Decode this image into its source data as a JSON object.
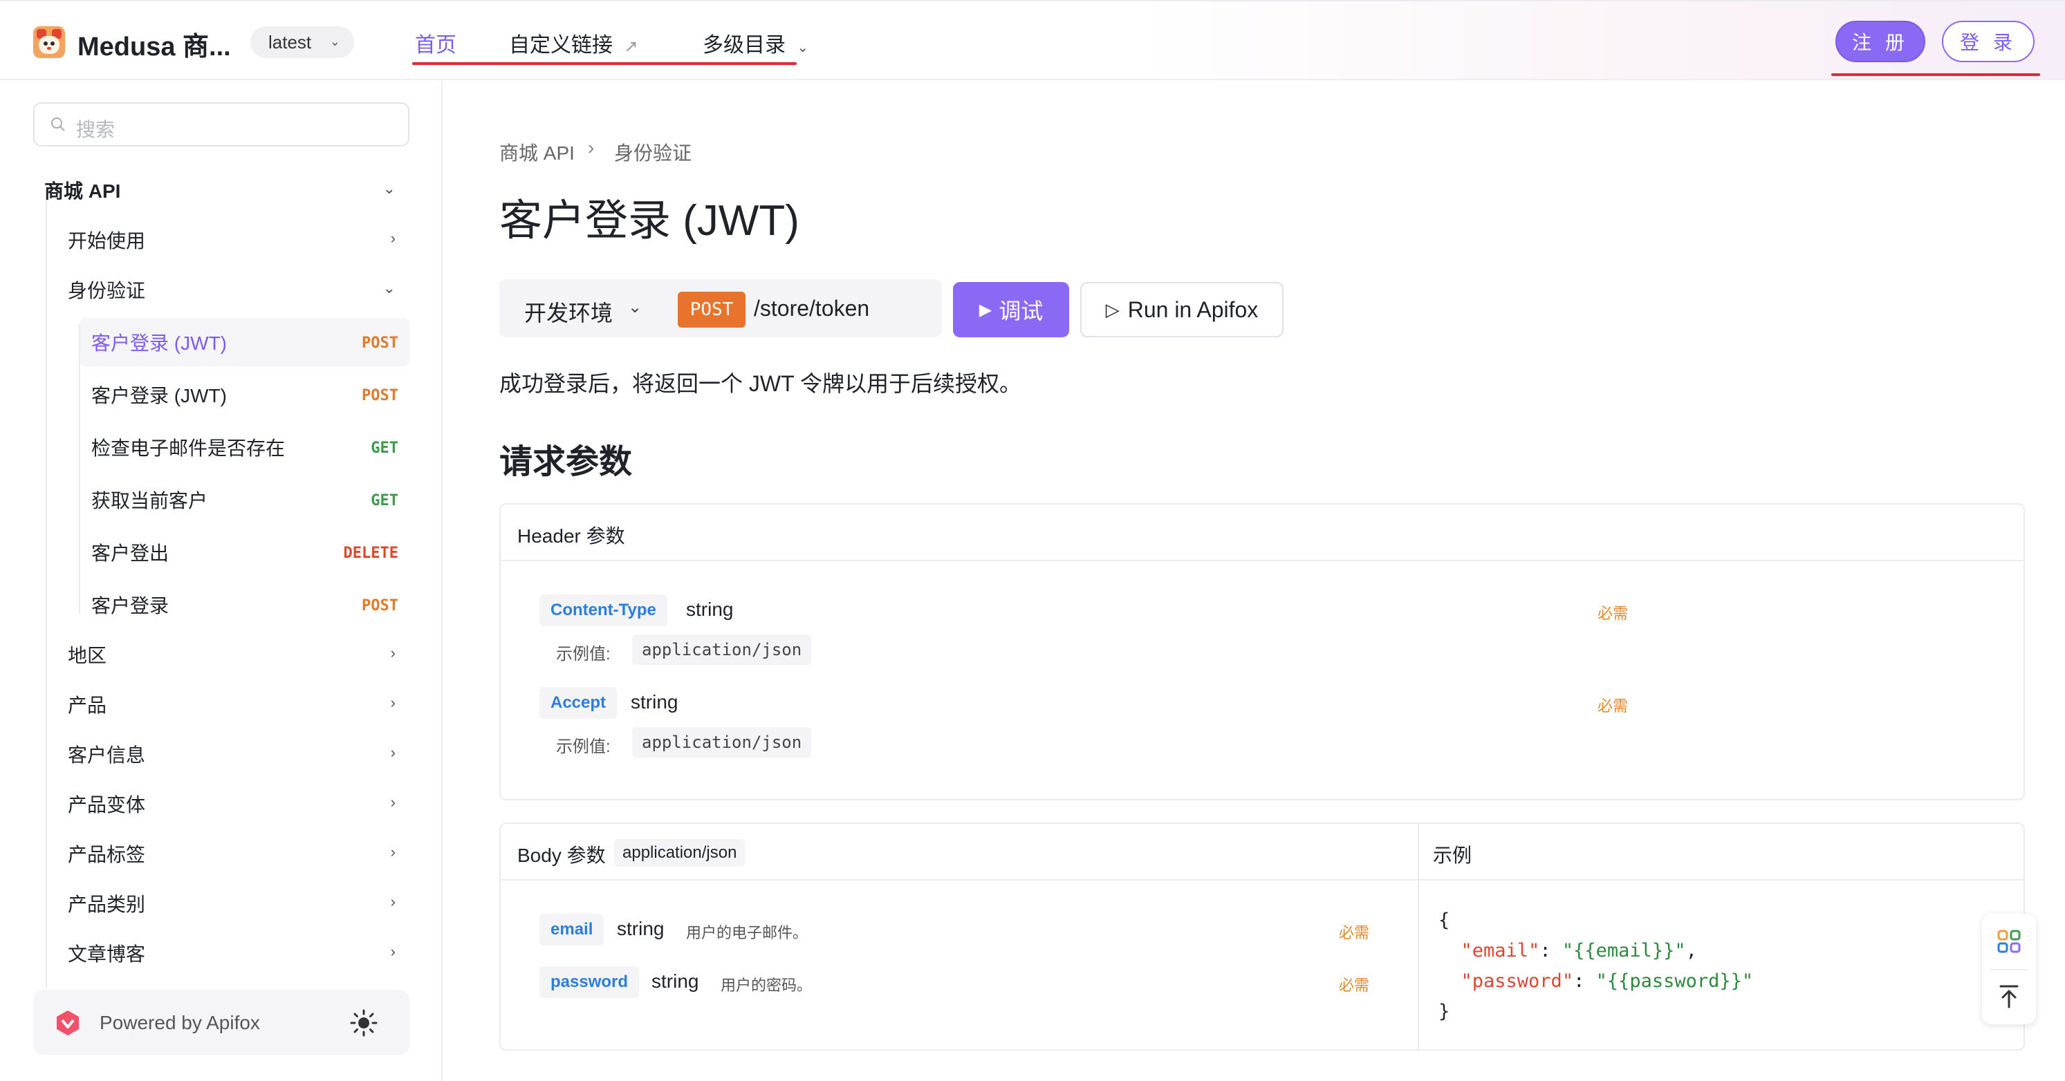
{
  "header": {
    "site_title": "Medusa 商...",
    "version": "latest",
    "nav": [
      {
        "label": "首页"
      },
      {
        "label": "自定义链接",
        "external_icon": "external-link-icon"
      },
      {
        "label": "多级目录",
        "dropdown_icon": "chevron-down-icon"
      }
    ],
    "register_label": "注 册",
    "login_label": "登 录"
  },
  "sidebar": {
    "search_placeholder": "搜索",
    "group": "商城 API",
    "items": [
      {
        "label": "开始使用"
      },
      {
        "label": "身份验证"
      },
      {
        "label": "客户登录 (JWT)",
        "method": "POST"
      },
      {
        "label": "客户登录 (JWT)",
        "method": "POST"
      },
      {
        "label": "检查电子邮件是否存在",
        "method": "GET"
      },
      {
        "label": "获取当前客户",
        "method": "GET"
      },
      {
        "label": "客户登出",
        "method": "DELETE"
      },
      {
        "label": "客户登录",
        "method": "POST"
      },
      {
        "label": "地区"
      },
      {
        "label": "产品"
      },
      {
        "label": "客户信息"
      },
      {
        "label": "产品变体"
      },
      {
        "label": "产品标签"
      },
      {
        "label": "产品类别"
      },
      {
        "label": "文章博客"
      }
    ],
    "powered_by": "Powered by Apifox"
  },
  "main": {
    "breadcrumb": [
      "商城 API",
      "身份验证"
    ],
    "title": "客户登录 (JWT)",
    "env_label": "开发环境",
    "method": "POST",
    "path": "/store/token",
    "debug_label": "调试",
    "apifox_label": "Run in Apifox",
    "description": "成功登录后，将返回一个 JWT 令牌以用于后续授权。",
    "section_title": "请求参数",
    "header_params": {
      "title": "Header 参数",
      "example_label": "示例值:",
      "params": [
        {
          "name": "Content-Type",
          "type": "string",
          "required": "必需",
          "example": "application/json"
        },
        {
          "name": "Accept",
          "type": "string",
          "required": "必需",
          "example": "application/json"
        }
      ]
    },
    "body_params": {
      "title": "Body 参数",
      "content_type": "application/json",
      "example_title": "示例",
      "params": [
        {
          "name": "email",
          "type": "string",
          "desc": "用户的电子邮件。",
          "required": "必需"
        },
        {
          "name": "password",
          "type": "string",
          "desc": "用户的密码。",
          "required": "必需"
        }
      ],
      "code": {
        "open": "{",
        "k1": "\"email\"",
        "v1": "\"{{email}}\"",
        "k2": "\"password\"",
        "v2": "\"{{password}}\"",
        "close": "}"
      }
    }
  },
  "colors": {
    "accent": "#8a6af5",
    "post": "#e07a2c",
    "get": "#3a9c4a",
    "delete": "#e0462f",
    "underline": "#e02a35"
  }
}
